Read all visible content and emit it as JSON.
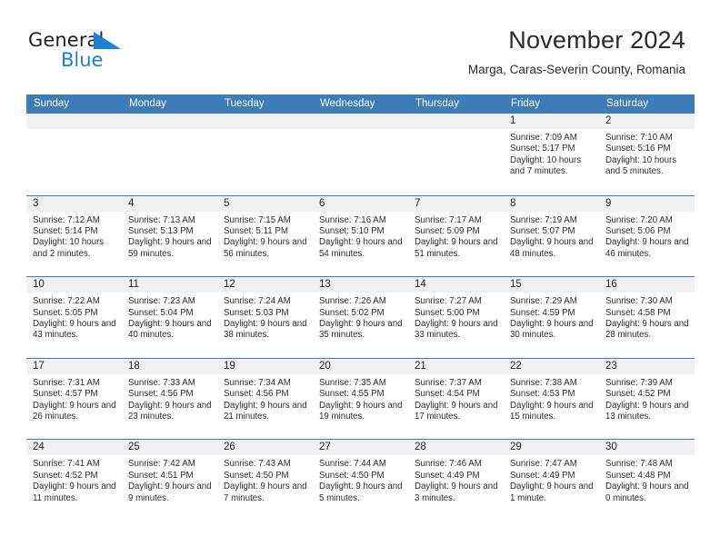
{
  "brand": {
    "name_top": "General",
    "name_bottom": "Blue",
    "triangle_icon": "triangle-icon",
    "accent_color": "#1b7fd4"
  },
  "header": {
    "title": "November 2024",
    "subtitle": "Marga, Caras-Severin County, Romania"
  },
  "theme": {
    "header_band": "#3b7cb9",
    "cell_head_bg": "#f0f0f0",
    "text": "#2d2d2d"
  },
  "weekdays": [
    "Sunday",
    "Monday",
    "Tuesday",
    "Wednesday",
    "Thursday",
    "Friday",
    "Saturday"
  ],
  "weeks": [
    [
      {
        "empty": true
      },
      {
        "empty": true
      },
      {
        "empty": true
      },
      {
        "empty": true
      },
      {
        "empty": true
      },
      {
        "day": "1",
        "sunrise": "Sunrise: 7:09 AM",
        "sunset": "Sunset: 5:17 PM",
        "daylight": "Daylight: 10 hours and 7 minutes."
      },
      {
        "day": "2",
        "sunrise": "Sunrise: 7:10 AM",
        "sunset": "Sunset: 5:16 PM",
        "daylight": "Daylight: 10 hours and 5 minutes."
      }
    ],
    [
      {
        "day": "3",
        "sunrise": "Sunrise: 7:12 AM",
        "sunset": "Sunset: 5:14 PM",
        "daylight": "Daylight: 10 hours and 2 minutes."
      },
      {
        "day": "4",
        "sunrise": "Sunrise: 7:13 AM",
        "sunset": "Sunset: 5:13 PM",
        "daylight": "Daylight: 9 hours and 59 minutes."
      },
      {
        "day": "5",
        "sunrise": "Sunrise: 7:15 AM",
        "sunset": "Sunset: 5:11 PM",
        "daylight": "Daylight: 9 hours and 56 minutes."
      },
      {
        "day": "6",
        "sunrise": "Sunrise: 7:16 AM",
        "sunset": "Sunset: 5:10 PM",
        "daylight": "Daylight: 9 hours and 54 minutes."
      },
      {
        "day": "7",
        "sunrise": "Sunrise: 7:17 AM",
        "sunset": "Sunset: 5:09 PM",
        "daylight": "Daylight: 9 hours and 51 minutes."
      },
      {
        "day": "8",
        "sunrise": "Sunrise: 7:19 AM",
        "sunset": "Sunset: 5:07 PM",
        "daylight": "Daylight: 9 hours and 48 minutes."
      },
      {
        "day": "9",
        "sunrise": "Sunrise: 7:20 AM",
        "sunset": "Sunset: 5:06 PM",
        "daylight": "Daylight: 9 hours and 46 minutes."
      }
    ],
    [
      {
        "day": "10",
        "sunrise": "Sunrise: 7:22 AM",
        "sunset": "Sunset: 5:05 PM",
        "daylight": "Daylight: 9 hours and 43 minutes."
      },
      {
        "day": "11",
        "sunrise": "Sunrise: 7:23 AM",
        "sunset": "Sunset: 5:04 PM",
        "daylight": "Daylight: 9 hours and 40 minutes."
      },
      {
        "day": "12",
        "sunrise": "Sunrise: 7:24 AM",
        "sunset": "Sunset: 5:03 PM",
        "daylight": "Daylight: 9 hours and 38 minutes."
      },
      {
        "day": "13",
        "sunrise": "Sunrise: 7:26 AM",
        "sunset": "Sunset: 5:02 PM",
        "daylight": "Daylight: 9 hours and 35 minutes."
      },
      {
        "day": "14",
        "sunrise": "Sunrise: 7:27 AM",
        "sunset": "Sunset: 5:00 PM",
        "daylight": "Daylight: 9 hours and 33 minutes."
      },
      {
        "day": "15",
        "sunrise": "Sunrise: 7:29 AM",
        "sunset": "Sunset: 4:59 PM",
        "daylight": "Daylight: 9 hours and 30 minutes."
      },
      {
        "day": "16",
        "sunrise": "Sunrise: 7:30 AM",
        "sunset": "Sunset: 4:58 PM",
        "daylight": "Daylight: 9 hours and 28 minutes."
      }
    ],
    [
      {
        "day": "17",
        "sunrise": "Sunrise: 7:31 AM",
        "sunset": "Sunset: 4:57 PM",
        "daylight": "Daylight: 9 hours and 26 minutes."
      },
      {
        "day": "18",
        "sunrise": "Sunrise: 7:33 AM",
        "sunset": "Sunset: 4:56 PM",
        "daylight": "Daylight: 9 hours and 23 minutes."
      },
      {
        "day": "19",
        "sunrise": "Sunrise: 7:34 AM",
        "sunset": "Sunset: 4:56 PM",
        "daylight": "Daylight: 9 hours and 21 minutes."
      },
      {
        "day": "20",
        "sunrise": "Sunrise: 7:35 AM",
        "sunset": "Sunset: 4:55 PM",
        "daylight": "Daylight: 9 hours and 19 minutes."
      },
      {
        "day": "21",
        "sunrise": "Sunrise: 7:37 AM",
        "sunset": "Sunset: 4:54 PM",
        "daylight": "Daylight: 9 hours and 17 minutes."
      },
      {
        "day": "22",
        "sunrise": "Sunrise: 7:38 AM",
        "sunset": "Sunset: 4:53 PM",
        "daylight": "Daylight: 9 hours and 15 minutes."
      },
      {
        "day": "23",
        "sunrise": "Sunrise: 7:39 AM",
        "sunset": "Sunset: 4:52 PM",
        "daylight": "Daylight: 9 hours and 13 minutes."
      }
    ],
    [
      {
        "day": "24",
        "sunrise": "Sunrise: 7:41 AM",
        "sunset": "Sunset: 4:52 PM",
        "daylight": "Daylight: 9 hours and 11 minutes."
      },
      {
        "day": "25",
        "sunrise": "Sunrise: 7:42 AM",
        "sunset": "Sunset: 4:51 PM",
        "daylight": "Daylight: 9 hours and 9 minutes."
      },
      {
        "day": "26",
        "sunrise": "Sunrise: 7:43 AM",
        "sunset": "Sunset: 4:50 PM",
        "daylight": "Daylight: 9 hours and 7 minutes."
      },
      {
        "day": "27",
        "sunrise": "Sunrise: 7:44 AM",
        "sunset": "Sunset: 4:50 PM",
        "daylight": "Daylight: 9 hours and 5 minutes."
      },
      {
        "day": "28",
        "sunrise": "Sunrise: 7:46 AM",
        "sunset": "Sunset: 4:49 PM",
        "daylight": "Daylight: 9 hours and 3 minutes."
      },
      {
        "day": "29",
        "sunrise": "Sunrise: 7:47 AM",
        "sunset": "Sunset: 4:49 PM",
        "daylight": "Daylight: 9 hours and 1 minute."
      },
      {
        "day": "30",
        "sunrise": "Sunrise: 7:48 AM",
        "sunset": "Sunset: 4:48 PM",
        "daylight": "Daylight: 9 hours and 0 minutes."
      }
    ]
  ]
}
